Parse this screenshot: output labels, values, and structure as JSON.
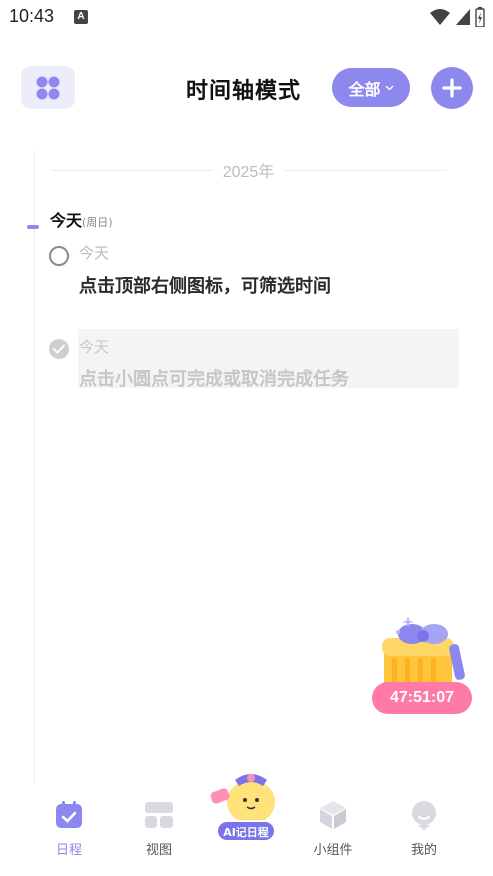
{
  "status_bar": {
    "time": "10:43",
    "notification_badge": "A",
    "icons": [
      "wifi-icon",
      "signal-icon",
      "battery-icon"
    ]
  },
  "header": {
    "title": "时间轴模式",
    "filter_label": "全部",
    "menu_icon": "grid-icon",
    "add_icon": "plus-icon"
  },
  "timeline": {
    "year": "2025年",
    "day": {
      "label": "今天",
      "weekday": "(周日)"
    },
    "tasks": [
      {
        "date": "今天",
        "title": "点击顶部右侧图标，可筛选时间",
        "completed": false
      },
      {
        "date": "今天",
        "title": "点击小圆点可完成或取消完成任务",
        "completed": true
      }
    ]
  },
  "gift_widget": {
    "countdown": "47:51:07",
    "icon": "gift-box-icon"
  },
  "bottom_nav": {
    "items": [
      {
        "label": "日程",
        "icon": "calendar-icon",
        "active": true
      },
      {
        "label": "视图",
        "icon": "layout-icon",
        "active": false
      },
      {
        "label": "AI记日程",
        "icon": "ai-mascot-icon",
        "active": false
      },
      {
        "label": "小组件",
        "icon": "cube-icon",
        "active": false
      },
      {
        "label": "我的",
        "icon": "profile-icon",
        "active": false
      }
    ]
  },
  "colors": {
    "accent": "#8c88ee",
    "countdown": "#ff7aa6",
    "gift_body": "#ffc53d",
    "gift_ribbon": "#8c88ee"
  }
}
